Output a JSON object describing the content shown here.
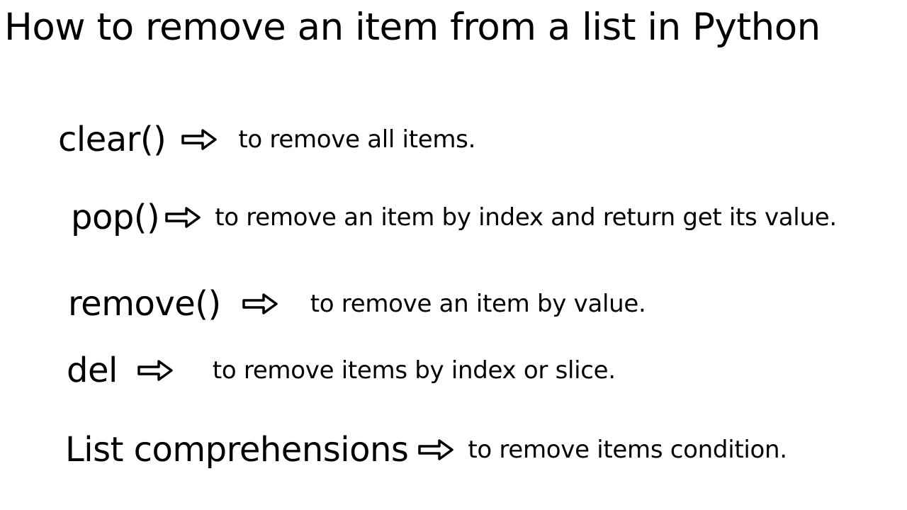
{
  "title": "How to remove an item from a list in Python",
  "rows": [
    {
      "method": "clear()",
      "description": "to remove all items."
    },
    {
      "method": "pop()",
      "description": "to remove an item by index and return get its value."
    },
    {
      "method": "remove()",
      "description": "to remove an item by value."
    },
    {
      "method": "del",
      "description": "to remove items by index or slice."
    },
    {
      "method": "List comprehensions",
      "description": "to remove items condition."
    }
  ]
}
